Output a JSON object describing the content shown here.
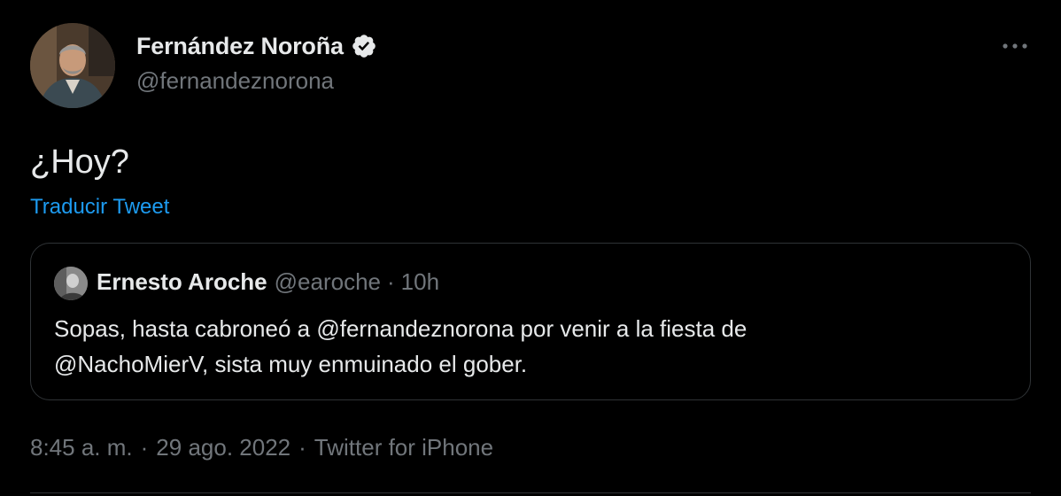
{
  "tweet": {
    "author": {
      "name": "Fernández Noroña",
      "handle": "@fernandeznorona",
      "verified": true
    },
    "text": "¿Hoy?",
    "translate_label": "Traducir Tweet",
    "quoted": {
      "author_name": "Ernesto Aroche",
      "handle": "@earoche",
      "separator": "·",
      "time": "10h",
      "text_line1": "Sopas, hasta cabroneó a @fernandeznorona por venir a la fiesta de",
      "text_line2": "@NachoMierV, sista muy enmuinado el gober."
    },
    "meta": {
      "time": "8:45 a. m.",
      "separator": "·",
      "date": "29 ago. 2022",
      "source": "Twitter for iPhone"
    }
  },
  "colors": {
    "background": "#000000",
    "text_primary": "#e7e9ea",
    "text_secondary": "#71767b",
    "accent": "#1d9bf0",
    "border": "#2f3336"
  },
  "icons": {
    "verified": "verified-badge-icon",
    "more": "more-options-icon"
  }
}
